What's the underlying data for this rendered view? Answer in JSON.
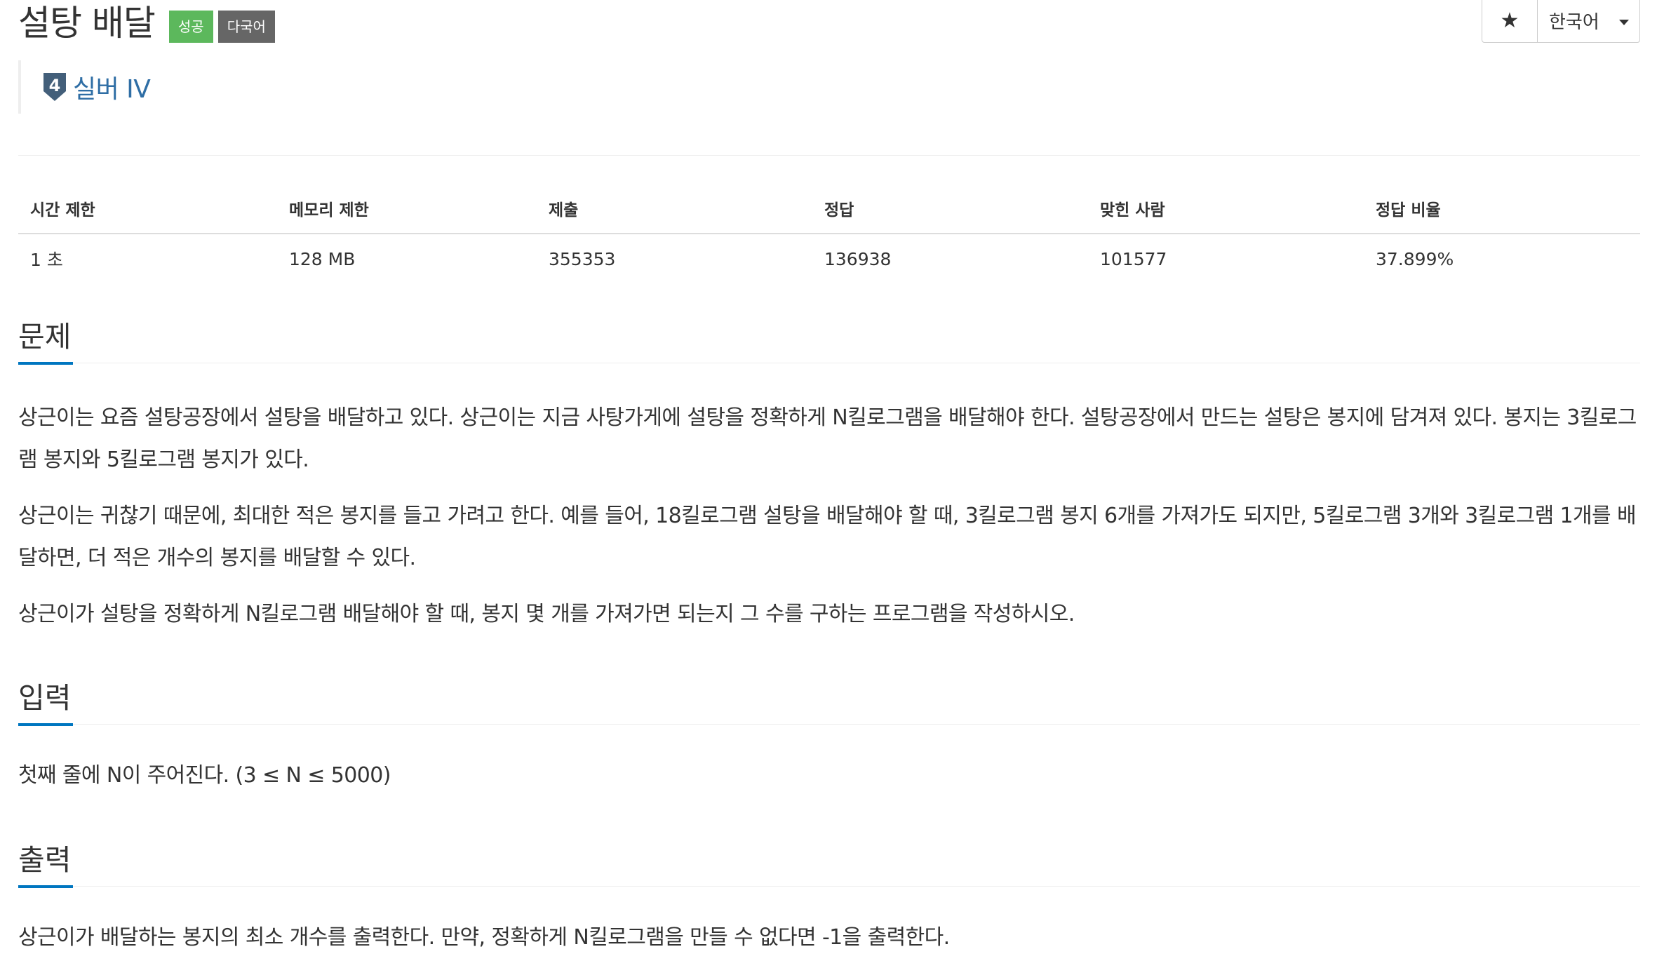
{
  "header": {
    "title": "설탕 배달",
    "badges": {
      "success": "성공",
      "multilang": "다국어"
    },
    "tier_number": "4",
    "tier_label": "실버 IV",
    "star_glyph": "★",
    "language": "한국어"
  },
  "stats": {
    "headers": [
      "시간 제한",
      "메모리 제한",
      "제출",
      "정답",
      "맞힌 사람",
      "정답 비율"
    ],
    "values": [
      "1 초",
      "128 MB",
      "355353",
      "136938",
      "101577",
      "37.899%"
    ]
  },
  "sections": {
    "problem": {
      "heading": "문제",
      "paragraphs": [
        "상근이는 요즘 설탕공장에서 설탕을 배달하고 있다. 상근이는 지금 사탕가게에 설탕을 정확하게 N킬로그램을 배달해야 한다. 설탕공장에서 만드는 설탕은 봉지에 담겨져 있다. 봉지는 3킬로그램 봉지와 5킬로그램 봉지가 있다.",
        "상근이는 귀찮기 때문에, 최대한 적은 봉지를 들고 가려고 한다. 예를 들어, 18킬로그램 설탕을 배달해야 할 때, 3킬로그램 봉지 6개를 가져가도 되지만, 5킬로그램 3개와 3킬로그램 1개를 배달하면, 더 적은 개수의 봉지를 배달할 수 있다.",
        "상근이가 설탕을 정확하게 N킬로그램 배달해야 할 때, 봉지 몇 개를 가져가면 되는지 그 수를 구하는 프로그램을 작성하시오."
      ]
    },
    "input": {
      "heading": "입력",
      "paragraphs": [
        "첫째 줄에 N이 주어진다. (3 ≤ N ≤ 5000)"
      ]
    },
    "output": {
      "heading": "출력",
      "paragraphs": [
        "상근이가 배달하는 봉지의 최소 개수를 출력한다. 만약, 정확하게 N킬로그램을 만들 수 없다면 -1을 출력한다."
      ]
    }
  },
  "colors": {
    "success_badge": "#5cb85c",
    "multilang_badge": "#666666",
    "tier_silver": "#435f7a",
    "tier_text": "#2f6ea5",
    "section_underline": "#0076c0"
  }
}
